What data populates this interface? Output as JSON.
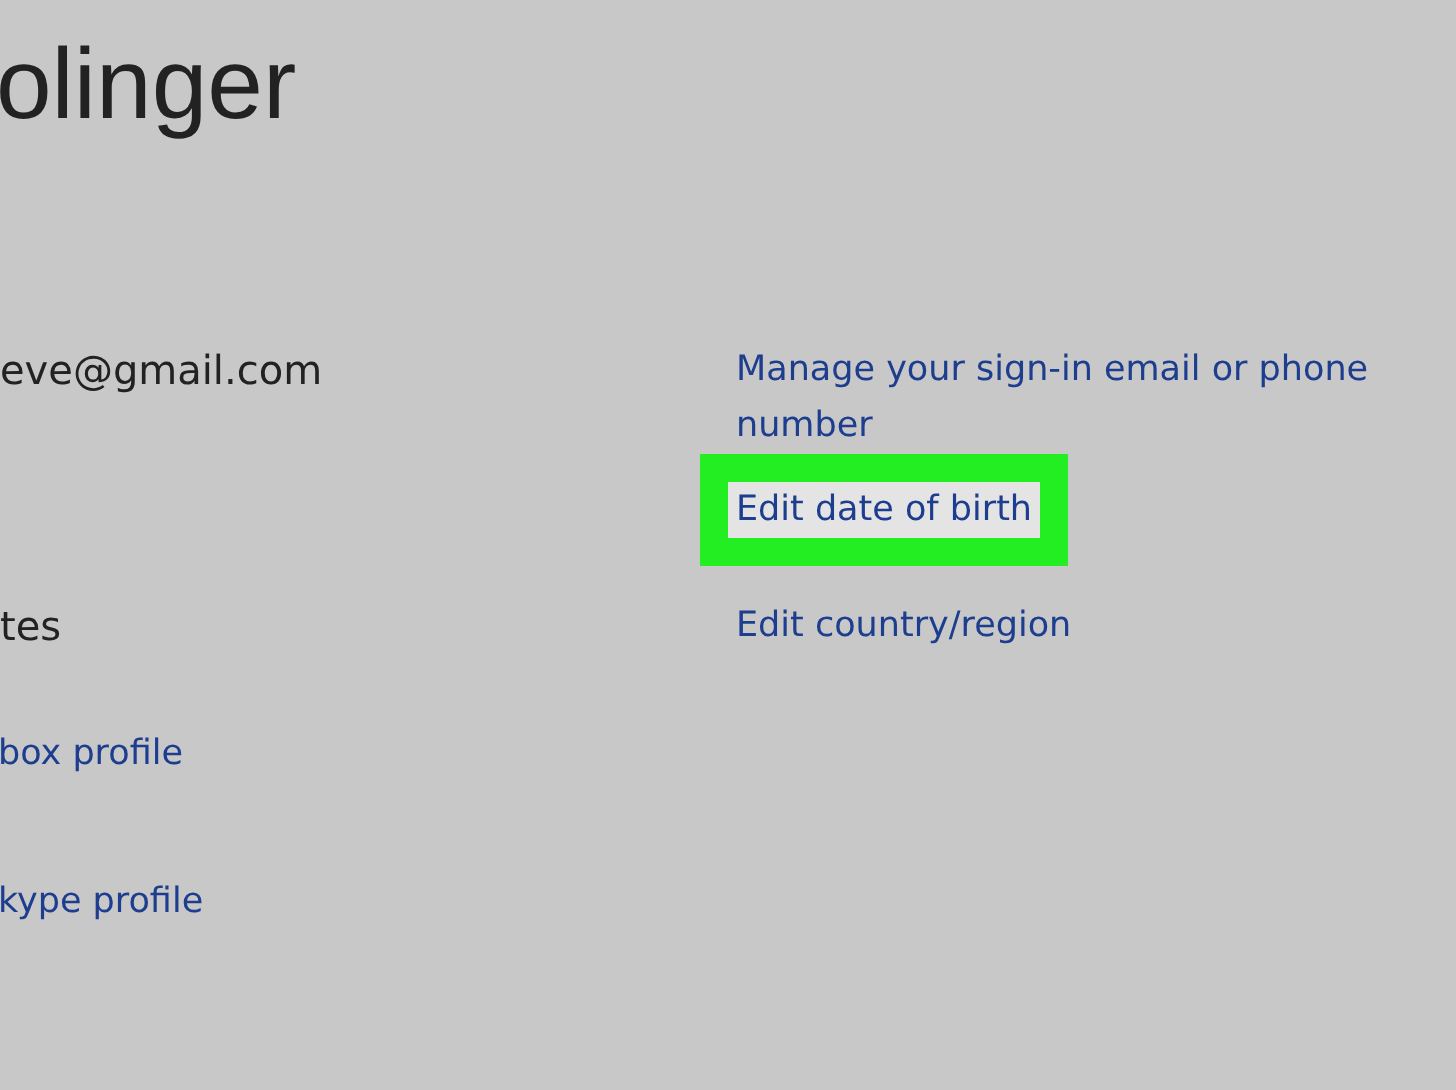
{
  "header": {
    "title": "olinger"
  },
  "rows": [
    {
      "label": "eve@gmail.com",
      "kind": "text",
      "action": "Manage your sign-in email or phone number",
      "highlighted": false
    },
    {
      "action": "Edit date of birth",
      "highlighted": true
    },
    {
      "label": "tes",
      "kind": "text",
      "action": "Edit country/region",
      "highlighted": false
    },
    {
      "label": "box profile",
      "kind": "link"
    },
    {
      "label": "kype profile",
      "kind": "link"
    }
  ]
}
